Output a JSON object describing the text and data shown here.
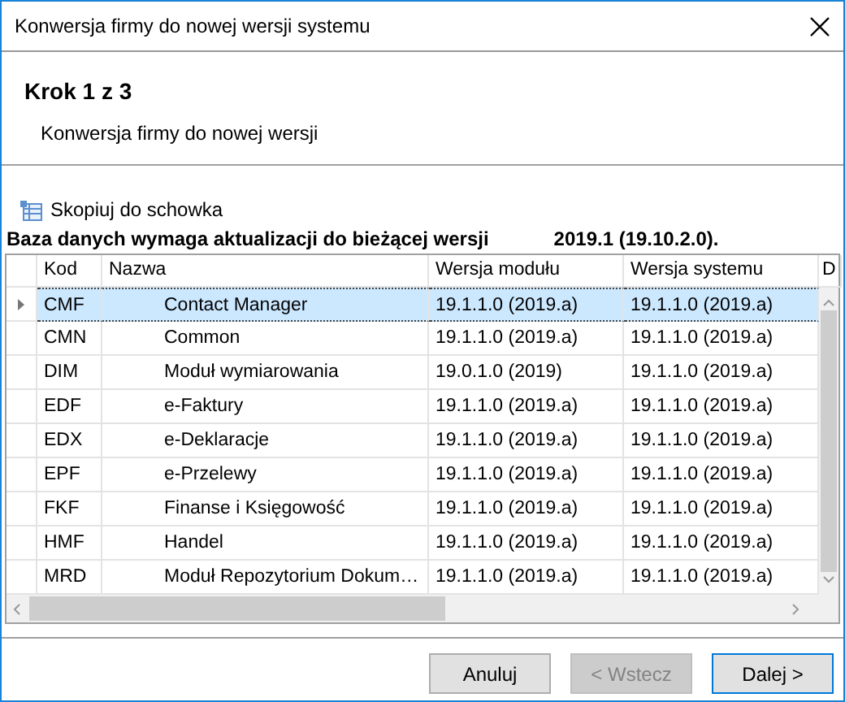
{
  "window": {
    "title": "Konwersja firmy do nowej wersji systemu"
  },
  "step": {
    "title": "Krok 1 z 3",
    "subtitle": "Konwersja firmy do nowej wersji"
  },
  "copy_link": "Skopiuj do schowka",
  "message": {
    "text": "Baza danych wymaga aktualizacji do bieżącej wersji",
    "version": "2019.1 (19.10.2.0)."
  },
  "table": {
    "columns": [
      "Kod",
      "Nazwa",
      "Wersja modułu",
      "Wersja systemu",
      "D"
    ],
    "rows": [
      {
        "kod": "CMF",
        "nazwa": "Contact Manager",
        "modul": "19.1.1.0 (2019.a)",
        "system": "19.1.1.0 (2019.a)",
        "selected": true
      },
      {
        "kod": "CMN",
        "nazwa": "Common",
        "modul": "19.1.1.0 (2019.a)",
        "system": "19.1.1.0 (2019.a)",
        "selected": false
      },
      {
        "kod": "DIM",
        "nazwa": "Moduł wymiarowania",
        "modul": "19.0.1.0 (2019)",
        "system": "19.1.1.0 (2019.a)",
        "selected": false
      },
      {
        "kod": "EDF",
        "nazwa": "e-Faktury",
        "modul": "19.1.1.0 (2019.a)",
        "system": "19.1.1.0 (2019.a)",
        "selected": false
      },
      {
        "kod": "EDX",
        "nazwa": "e-Deklaracje",
        "modul": "19.1.1.0 (2019.a)",
        "system": "19.1.1.0 (2019.a)",
        "selected": false
      },
      {
        "kod": "EPF",
        "nazwa": "e-Przelewy",
        "modul": "19.1.1.0 (2019.a)",
        "system": "19.1.1.0 (2019.a)",
        "selected": false
      },
      {
        "kod": "FKF",
        "nazwa": "Finanse i Księgowość",
        "modul": "19.1.1.0 (2019.a)",
        "system": "19.1.1.0 (2019.a)",
        "selected": false
      },
      {
        "kod": "HMF",
        "nazwa": "Handel",
        "modul": "19.1.1.0 (2019.a)",
        "system": "19.1.1.0 (2019.a)",
        "selected": false
      },
      {
        "kod": "MRD",
        "nazwa": "Moduł Repozytorium Dokum…",
        "modul": "19.1.1.0 (2019.a)",
        "system": "19.1.1.0 (2019.a)",
        "selected": false
      }
    ]
  },
  "buttons": [
    {
      "label": "Anuluj",
      "kind": "normal",
      "disabled": false
    },
    {
      "label": "< Wstecz",
      "kind": "normal",
      "disabled": true
    },
    {
      "label": "Dalej >",
      "kind": "default",
      "disabled": false
    }
  ]
}
